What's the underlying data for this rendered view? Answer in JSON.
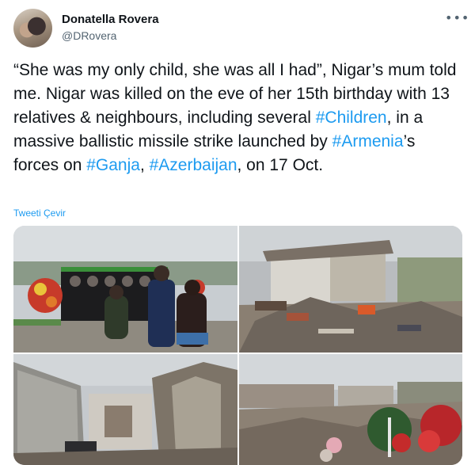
{
  "tweet": {
    "author_name": "Donatella Rovera",
    "author_handle": "@DRovera",
    "more_icon": "more-horizontal-icon",
    "text_parts": {
      "p1": "“She was my only child, she was all I had”, Nigar’s mum told me. Nigar was killed on the eve of her 15th birthday with 13 relatives & neighbours, including several ",
      "h1": "#Children",
      "p2": ", in a massive ballistic missile strike launched by ",
      "h2": "#Armenia",
      "p3": "’s forces on ",
      "h3": "#Ganja",
      "p4": ", ",
      "h4": "#Azerbaijan",
      "p5": ", on 17 Oct."
    },
    "translate_label": "Tweeti Çevir",
    "link_color": "#1d9bf0"
  }
}
